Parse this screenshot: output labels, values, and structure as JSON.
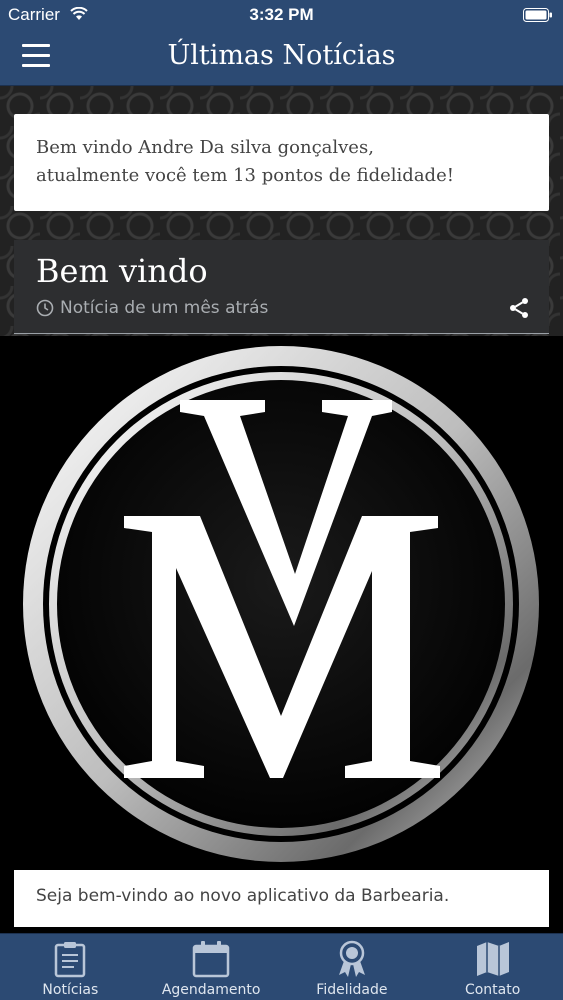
{
  "status_bar": {
    "carrier": "Carrier",
    "time": "3:32 PM"
  },
  "navbar": {
    "title": "Últimas Notícias"
  },
  "welcome": {
    "line1": "Bem vindo Andre Da silva gonçalves,",
    "line2": "atualmente você tem 13 pontos de fidelidade!"
  },
  "news": {
    "title": "Bem vindo",
    "meta": "Notícia de um mês atrás",
    "body": "Seja bem-vindo ao novo aplicativo da Barbearia."
  },
  "tabs": [
    {
      "label": "Notícias",
      "icon": "clipboard-icon"
    },
    {
      "label": "Agendamento",
      "icon": "calendar-icon"
    },
    {
      "label": "Fidelidade",
      "icon": "award-ribbon-icon"
    },
    {
      "label": "Contato",
      "icon": "map-icon"
    }
  ],
  "colors": {
    "primary": "#2c4a73",
    "card_dark": "#2d2e30",
    "text_muted": "#a9adb1"
  }
}
